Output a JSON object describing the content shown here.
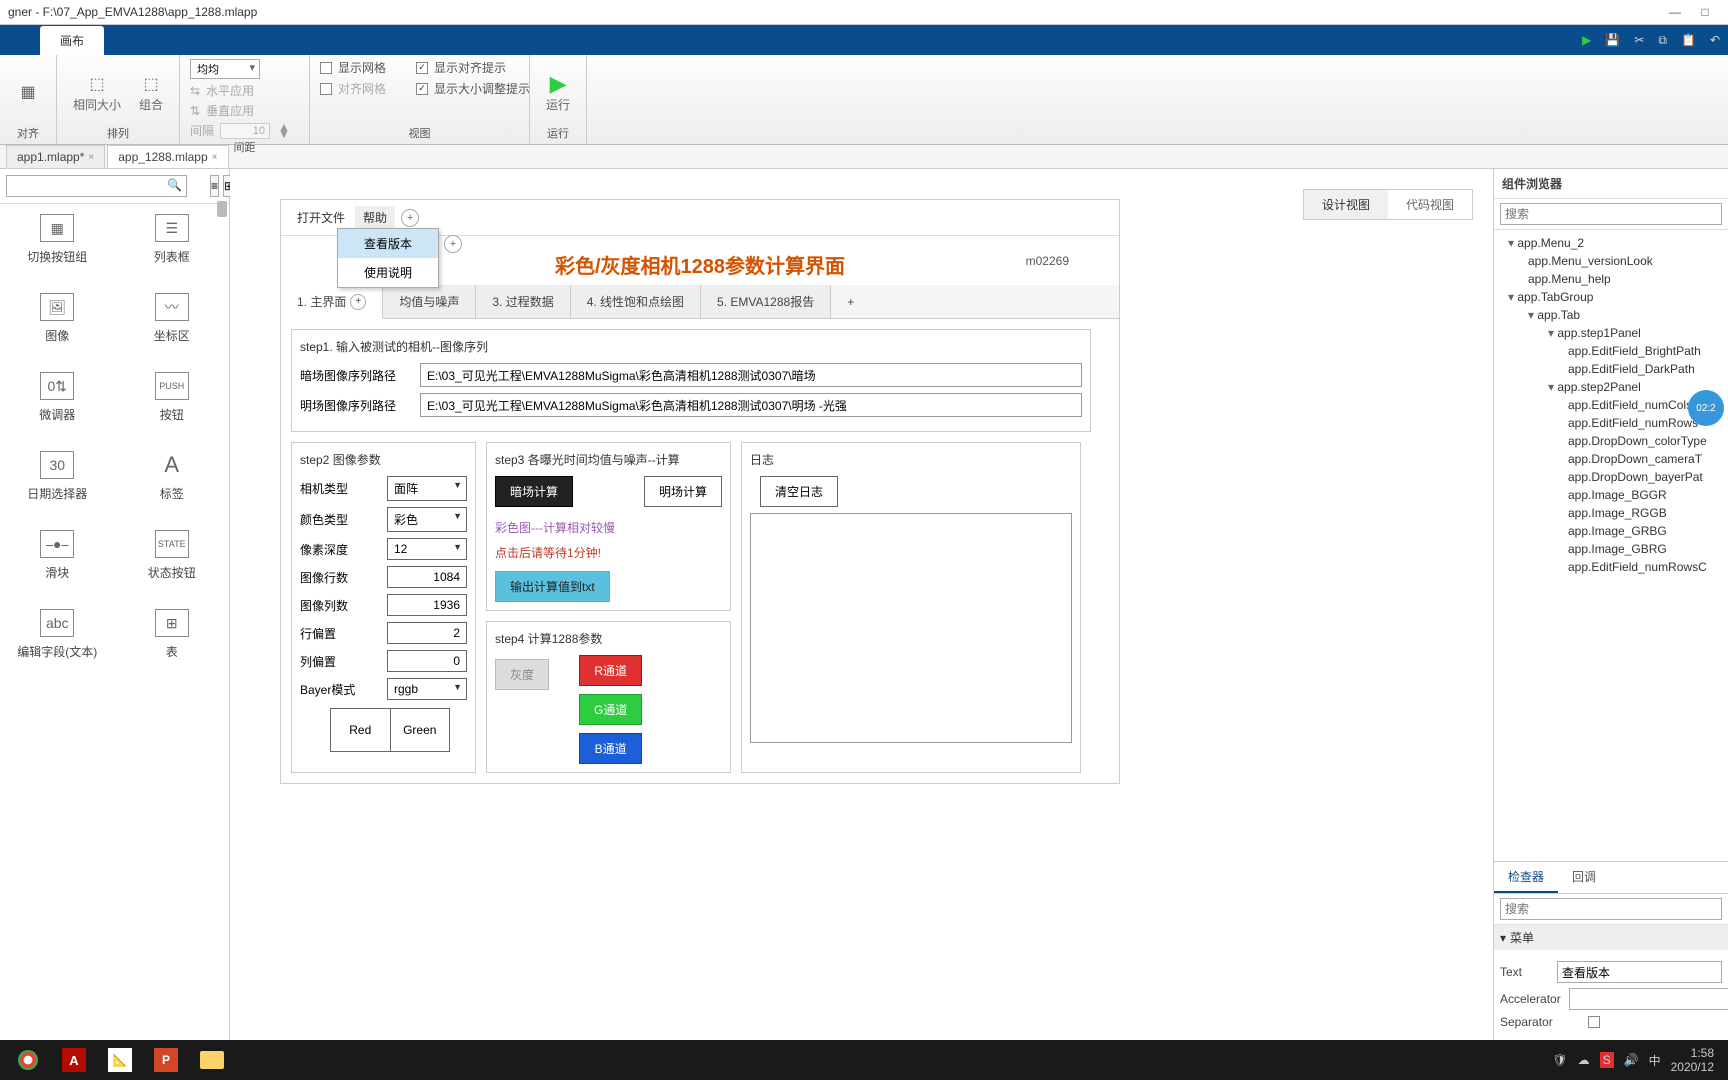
{
  "titlebar": {
    "title": "gner - F:\\07_App_EMVA1288\\app_1288.mlapp"
  },
  "bluebar": {
    "tab": "画布"
  },
  "ribbon": {
    "align_group": "对齐",
    "arrange_group": "排列",
    "same_size": "相同大小",
    "combine": "组合",
    "distribute_group": "间距",
    "distribute_combo": "均均",
    "horiz_apply": "水平应用",
    "vert_apply": "垂直应用",
    "spacing_label": "间隔",
    "spacing_val": "10",
    "view_group": "视图",
    "show_grid": "显示网格",
    "snap_grid": "对齐网格",
    "align_hint": "显示对齐提示",
    "resize_hint": "显示大小调整提示",
    "run_group": "运行",
    "run": "运行"
  },
  "filetabs": {
    "t1": "app1.mlapp*",
    "t2": "app_1288.mlapp"
  },
  "leftpanel": {
    "search_ph": "",
    "items": {
      "switchgrp": "切换按钮组",
      "listbox": "列表框",
      "image": "图像",
      "axes": "坐标区",
      "spinner": "微调器",
      "button": "按钮",
      "datepick": "日期选择器",
      "label": "标签",
      "slider": "滑块",
      "statebtn": "状态按钮",
      "editfield": "编辑字段(文本)",
      "table": "表"
    }
  },
  "viewtoggle": {
    "design": "设计视图",
    "code": "代码视图"
  },
  "appmenu": {
    "open": "打开文件",
    "help": "帮助",
    "ver": "查看版本",
    "manual": "使用说明"
  },
  "apptitle": "彩色/灰度相机1288参数计算界面",
  "appid": "m02269",
  "apptabs": {
    "t1": "1. 主界面",
    "t2": "均值与噪声",
    "t3": "3. 过程数据",
    "t4": "4. 线性饱和点绘图",
    "t5": "5. EMVA1288报告"
  },
  "step1": {
    "title": "step1. 输入被测试的相机--图像序列",
    "dark_label": "暗场图像序列路径",
    "dark_val": "E:\\03_可见光工程\\EMVA1288MuSigma\\彩色高清相机1288测试0307\\暗场",
    "bright_label": "明场图像序列路径",
    "bright_val": "E:\\03_可见光工程\\EMVA1288MuSigma\\彩色高清相机1288测试0307\\明场 -光强"
  },
  "step2": {
    "title": "step2  图像参数",
    "camtype_l": "相机类型",
    "camtype_v": "面阵",
    "colortype_l": "颜色类型",
    "colortype_v": "彩色",
    "pixdepth_l": "像素深度",
    "pixdepth_v": "12",
    "rows_l": "图像行数",
    "rows_v": "1084",
    "cols_l": "图像列数",
    "cols_v": "1936",
    "rowoff_l": "行偏置",
    "rowoff_v": "2",
    "coloff_l": "列偏置",
    "coloff_v": "0",
    "bayer_l": "Bayer模式",
    "bayer_v": "rggb",
    "red": "Red",
    "green": "Green"
  },
  "step3": {
    "title": "step3 各曝光时间均值与噪声--计算",
    "darkcalc": "暗场计算",
    "brightcalc": "明场计算",
    "note1": "彩色图---计算相对较慢",
    "note2": "点击后请等待1分钟!",
    "export": "输出计算值到txt"
  },
  "step4": {
    "title": "step4  计算1288参数",
    "gray": "灰度",
    "r": "R通道",
    "g": "G通道",
    "b": "B通道"
  },
  "log": {
    "title": "日志",
    "clear": "清空日志"
  },
  "rightpanel": {
    "title": "组件浏览器",
    "search_ph": "搜索",
    "tree": [
      {
        "lvl": 0,
        "exp": true,
        "t": "app.Menu_2"
      },
      {
        "lvl": 1,
        "t": "app.Menu_versionLook"
      },
      {
        "lvl": 1,
        "t": "app.Menu_help"
      },
      {
        "lvl": 0,
        "exp": true,
        "t": "app.TabGroup"
      },
      {
        "lvl": 1,
        "exp": true,
        "t": "app.Tab"
      },
      {
        "lvl": 2,
        "exp": true,
        "t": "app.step1Panel"
      },
      {
        "lvl": 3,
        "t": "app.EditField_BrightPath"
      },
      {
        "lvl": 3,
        "t": "app.EditField_DarkPath"
      },
      {
        "lvl": 2,
        "exp": true,
        "t": "app.step2Panel"
      },
      {
        "lvl": 3,
        "t": "app.EditField_numCols"
      },
      {
        "lvl": 3,
        "t": "app.EditField_numRows"
      },
      {
        "lvl": 3,
        "t": "app.DropDown_colorType"
      },
      {
        "lvl": 3,
        "t": "app.DropDown_cameraT"
      },
      {
        "lvl": 3,
        "t": "app.DropDown_bayerPat"
      },
      {
        "lvl": 3,
        "t": "app.Image_BGGR"
      },
      {
        "lvl": 3,
        "t": "app.Image_RGGB"
      },
      {
        "lvl": 3,
        "t": "app.Image_GRBG"
      },
      {
        "lvl": 3,
        "t": "app.Image_GBRG"
      },
      {
        "lvl": 3,
        "t": "app.EditField_numRowsC"
      }
    ],
    "inspector": "检查器",
    "callback": "回调",
    "insp_search_ph": "搜索",
    "menu_section": "菜单",
    "p_text": "Text",
    "p_text_v": "查看版本",
    "p_accel": "Accelerator",
    "p_sep": "Separator"
  },
  "timer": "02:2",
  "taskbar": {
    "time": "1:58",
    "date": "2020/12"
  }
}
